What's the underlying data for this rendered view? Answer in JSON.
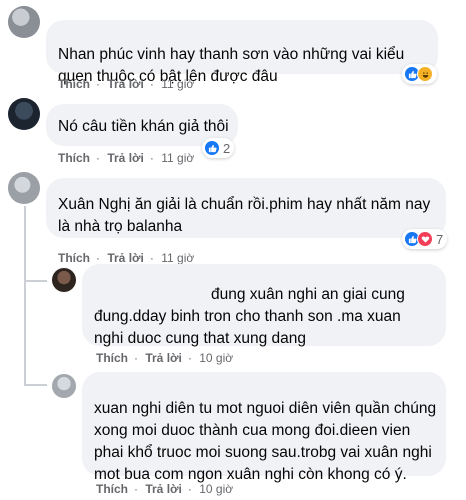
{
  "comments": [
    {
      "text": "Nhan phúc vinh hay thanh sơn vào những vai kiểu quen thuộc có bật lên được đâu",
      "like_label": "Thích",
      "reply_label": "Trả lời",
      "dot": "·",
      "time": "11 giờ",
      "reactions": [
        "like",
        "haha"
      ],
      "reaction_count": ""
    },
    {
      "text": "Nó câu tiền khán giả thôi",
      "like_label": "Thích",
      "reply_label": "Trả lời",
      "dot": "·",
      "time": "11 giờ",
      "reactions": [
        "like"
      ],
      "reaction_count": "2"
    },
    {
      "text": "Xuân Nghị ăn giải là chuẩn rồi.phim hay nhất năm nay là nhà trọ balanha",
      "like_label": "Thích",
      "reply_label": "Trả lời",
      "dot": "·",
      "time": "11 giờ",
      "reactions": [
        "like",
        "love"
      ],
      "reaction_count": "7"
    },
    {
      "text": "đung xuân nghi an giai cung đung.dday binh tron cho thanh son .ma xuan nghi duoc cung that xung dang",
      "like_label": "Thích",
      "reply_label": "Trả lời",
      "dot": "·",
      "time": "10 giờ"
    },
    {
      "text": "xuan nghi diên tu mot nguoi diên viên quần chúng xong moi duoc thành cua mong đoi.dieen vien phai khổ truoc moi suong sau.trobg vai xuân nghi mot bua com ngon xuân nghi còn khong có ý.",
      "like_label": "Thích",
      "reply_label": "Trả lời",
      "dot": "·",
      "time": "10 giờ"
    }
  ],
  "colors": {
    "bubble": "#f0f2f5",
    "meta": "#65676b",
    "like": "#1877f2",
    "haha": "#f7b125",
    "love": "#f33e58"
  }
}
